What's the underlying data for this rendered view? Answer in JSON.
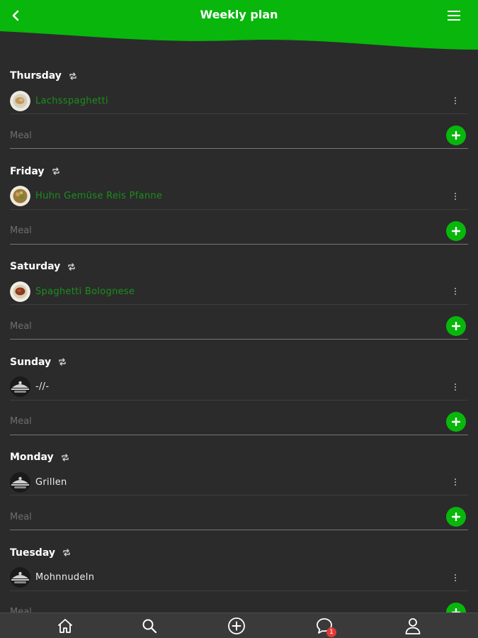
{
  "header": {
    "title": "Weekly plan",
    "back_icon": "chevron-left-icon",
    "menu_icon": "hamburger-menu-icon",
    "color": "#08b60c"
  },
  "days": [
    {
      "name": "Thursday",
      "meal": {
        "name": "Lachsspaghetti",
        "style": "green",
        "image": "dish-photo"
      },
      "input_placeholder": "Meal"
    },
    {
      "name": "Friday",
      "meal": {
        "name": "Huhn Gemüse Reis Pfanne",
        "style": "green",
        "image": "dish-photo"
      },
      "input_placeholder": "Meal"
    },
    {
      "name": "Saturday",
      "meal": {
        "name": "Spaghetti Bolognese",
        "style": "green",
        "image": "dish-photo"
      },
      "input_placeholder": "Meal"
    },
    {
      "name": "Sunday",
      "meal": {
        "name": "-//-",
        "style": "white",
        "image": "placeholder-plate"
      },
      "input_placeholder": "Meal"
    },
    {
      "name": "Monday",
      "meal": {
        "name": "Grillen",
        "style": "white",
        "image": "placeholder-plate"
      },
      "input_placeholder": "Meal"
    },
    {
      "name": "Tuesday",
      "meal": {
        "name": "Mohnnudeln",
        "style": "white",
        "image": "placeholder-plate"
      },
      "input_placeholder": "Meal"
    }
  ],
  "bottom_nav": {
    "items": [
      {
        "icon": "home-icon"
      },
      {
        "icon": "search-icon"
      },
      {
        "icon": "add-circle-icon"
      },
      {
        "icon": "chat-icon",
        "badge": "1"
      },
      {
        "icon": "profile-icon"
      }
    ]
  },
  "colors": {
    "accent": "#08b60c",
    "background": "#2b2b2b",
    "recipe_link": "#1a8f1a",
    "badge": "#e53935"
  }
}
